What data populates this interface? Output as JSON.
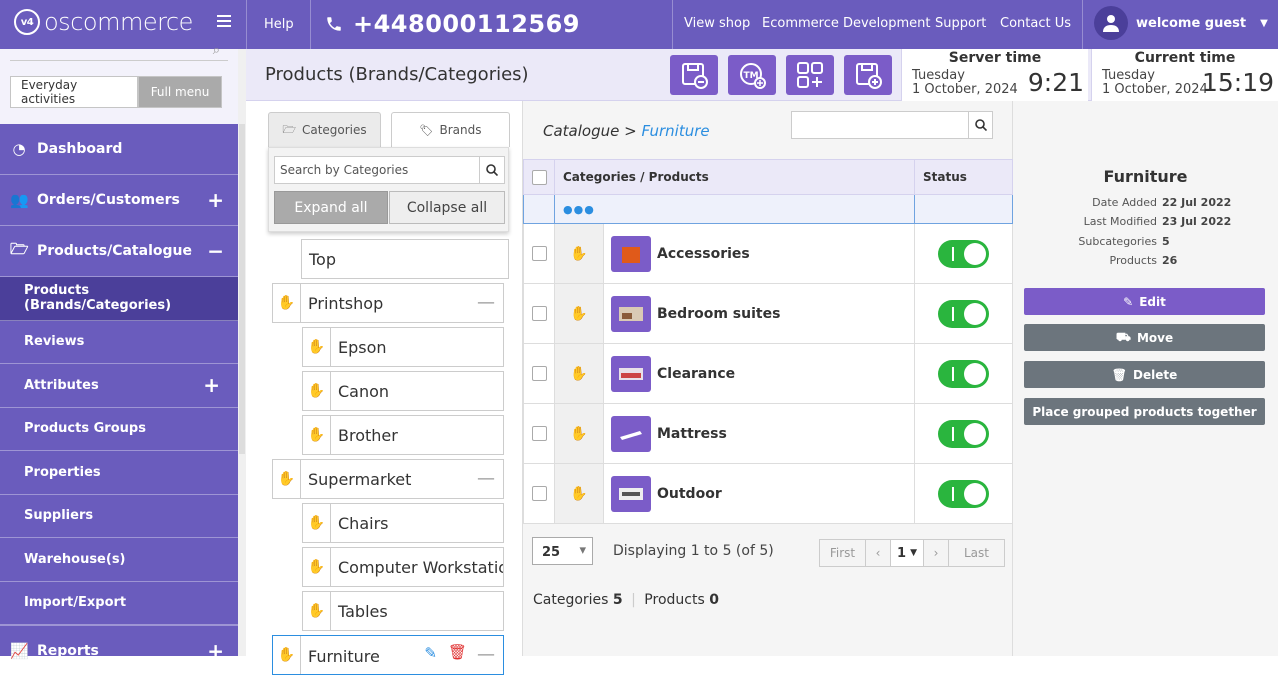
{
  "topbar": {
    "brand": "oscommerce",
    "brand_badge": "v4",
    "help": "Help",
    "phone": "+448000112569",
    "links": [
      "View shop",
      "Ecommerce Development",
      "Support",
      "Contact Us"
    ],
    "user": "welcome guest"
  },
  "sidebar": {
    "tab_everyday": "Everyday activities",
    "tab_full": "Full menu",
    "main_items": [
      {
        "label": "Dashboard",
        "icon": "dashboard-icon",
        "toggle": ""
      },
      {
        "label": "Orders/Customers",
        "icon": "users-icon",
        "toggle": "+"
      },
      {
        "label": "Products/Catalogue",
        "icon": "folder-open-icon",
        "toggle": "−"
      }
    ],
    "sub_items": [
      {
        "label": "Products (Brands/Categories)",
        "toggle": ""
      },
      {
        "label": "Reviews",
        "toggle": ""
      },
      {
        "label": "Attributes",
        "toggle": "+"
      },
      {
        "label": "Products Groups",
        "toggle": ""
      },
      {
        "label": "Properties",
        "toggle": ""
      },
      {
        "label": "Suppliers",
        "toggle": ""
      },
      {
        "label": "Warehouse(s)",
        "toggle": ""
      },
      {
        "label": "Import/Export",
        "toggle": ""
      }
    ],
    "reports": {
      "label": "Reports",
      "icon": "chart-icon",
      "toggle": "+"
    }
  },
  "header": {
    "title": "Products (Brands/Categories)",
    "server_time_label": "Server time",
    "server_day": "Tuesday",
    "server_date": "1 October, 2024",
    "server_clock": "9:21",
    "current_time_label": "Current time",
    "current_day": "Tuesday",
    "current_date": "1 October, 2024",
    "current_clock": "15:19"
  },
  "left_panel": {
    "tab_categories": "Categories",
    "tab_brands": "Brands",
    "search_placeholder": "Search by Categories",
    "expand_all": "Expand all",
    "collapse_all": "Collapse all",
    "tree": [
      {
        "label": "Top"
      },
      {
        "label": "Printshop"
      },
      {
        "label": "Epson"
      },
      {
        "label": "Canon"
      },
      {
        "label": "Brother"
      },
      {
        "label": "Supermarket"
      },
      {
        "label": "Chairs"
      },
      {
        "label": "Computer Workstatio"
      },
      {
        "label": "Tables"
      },
      {
        "label": "Furniture"
      }
    ]
  },
  "catalogue": {
    "breadcrumb_root": "Catalogue",
    "breadcrumb_sep": " > ",
    "breadcrumb_current": "Furniture",
    "col_name": "Categories / Products",
    "col_status": "Status",
    "loading": "●●●",
    "rows": [
      {
        "name": "Accessories",
        "status": "on"
      },
      {
        "name": "Bedroom suites",
        "status": "on"
      },
      {
        "name": "Clearance",
        "status": "on"
      },
      {
        "name": "Mattress",
        "status": "on"
      },
      {
        "name": "Outdoor",
        "status": "on"
      }
    ],
    "per_page": "25",
    "displaying": "Displaying 1 to 5 (of 5)",
    "first": "First",
    "page": "1",
    "last": "Last",
    "categories_label": "Categories",
    "categories_count": "5",
    "products_label": "Products",
    "products_count": "0"
  },
  "info": {
    "title": "Furniture",
    "date_added_label": "Date Added",
    "date_added": "22 Jul 2022",
    "last_modified_label": "Last Modified",
    "last_modified": "23 Jul 2022",
    "subcategories_label": "Subcategories",
    "subcategories": "5",
    "products_label": "Products",
    "products": "26",
    "edit": "Edit",
    "move": "Move",
    "delete": "Delete",
    "group": "Place grouped products together"
  },
  "colors": {
    "primary": "#6a5cbd",
    "dark": "#4b3f9a",
    "button": "#7b5cc8",
    "grey_button": "#6c757d",
    "toggle_on": "#2ab53e",
    "link": "#2b8ee0"
  }
}
